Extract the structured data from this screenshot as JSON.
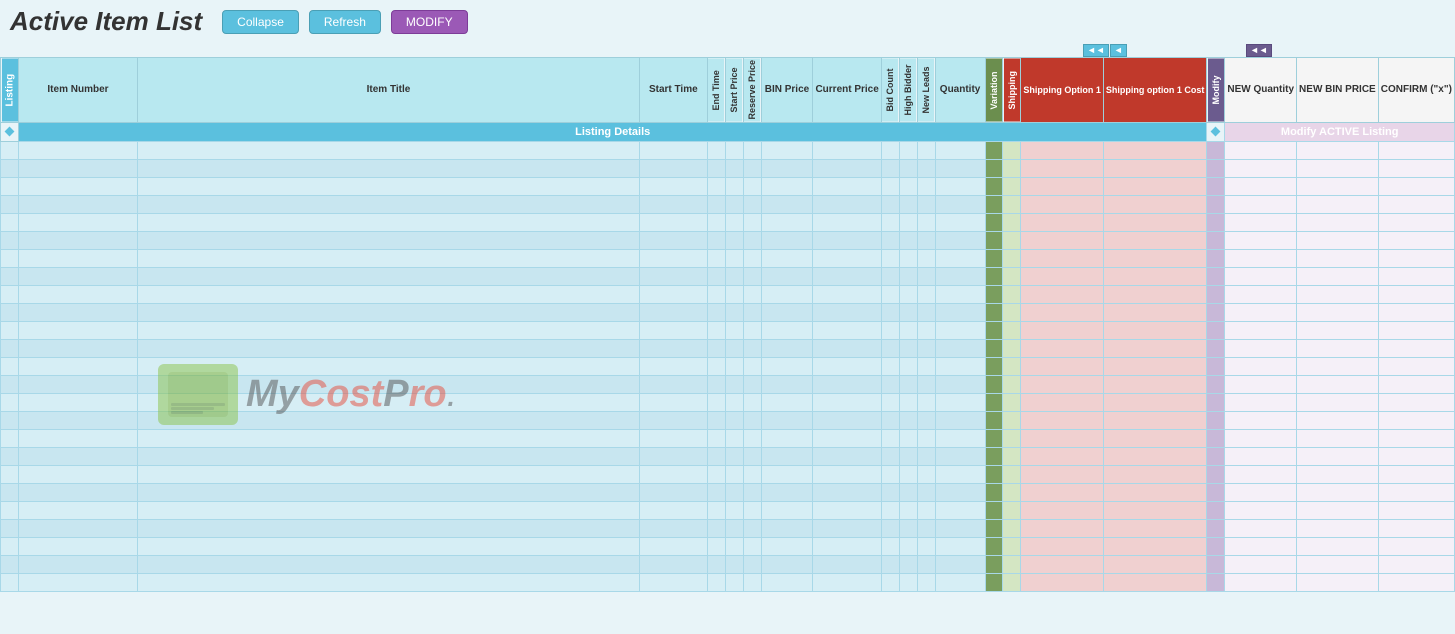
{
  "header": {
    "title": "Active Item List",
    "buttons": {
      "collapse": "Collapse",
      "refresh": "Refresh",
      "modify": "MODIFY"
    }
  },
  "nav_arrows": {
    "left_double": "◄◄",
    "left_single": "◄",
    "right_double": "►►",
    "right_single": "►"
  },
  "table": {
    "columns": {
      "listing": "Listing",
      "item_number": "Item Number",
      "item_title": "Item Title",
      "start_time": "Start Time",
      "end_time": "End Time",
      "start_price": "Start Price",
      "reserve_price": "Reserve Price",
      "bin_price": "BIN Price",
      "current_price": "Current Price",
      "bid_count": "Bid Count",
      "high_bidder": "High Bidder",
      "new_leads": "New Leads",
      "quantity": "Quantity",
      "variation": "Variation",
      "shipping": "Shipping",
      "shipping_option_1": "Shipping Option 1",
      "shipping_option_1_cost": "Shipping option 1 Cost",
      "modify": "Modify",
      "new_quantity": "NEW Quantity",
      "new_bin_price": "NEW BIN PRICE",
      "confirm": "CONFIRM (\"x\")"
    },
    "listing_details_label": "Listing Details",
    "modify_active_label": "Modify ACTIVE Listing",
    "num_rows": 25
  },
  "watermark": {
    "text": "MyCostPro",
    "text_prefix": "My",
    "text_suffix_color": "#e74c3c",
    "suffix": "Pro"
  }
}
